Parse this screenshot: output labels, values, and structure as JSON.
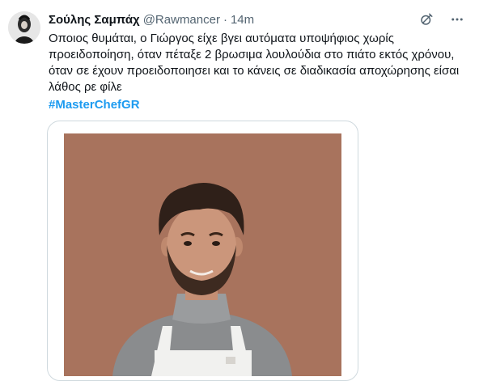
{
  "tweet": {
    "author_name": "Σούλης Σαμπάχ",
    "handle": "@Rawmancer",
    "separator": "·",
    "time": "14m",
    "lines": [
      "Οποιος θυμάται, ο Γιώργος είχε βγει αυτόματα υποψήφιος χωρίς",
      "προειδοποίηση, όταν πέταξε 2 βρωσιμα λουλούδια στο πιάτο εκτός χρόνου,",
      "όταν σε έχουν προειδοποιησει και το κάνεις σε διαδικασία αποχώρησης είσαι",
      "λάθος ρε φίλε"
    ],
    "hashtag": "#MasterChefGR"
  },
  "icons": {
    "grok": "grok-icon",
    "more": "more-options-icon"
  },
  "colors": {
    "hashtag": "#1d9bf0",
    "photo_background": "#a8735d"
  }
}
